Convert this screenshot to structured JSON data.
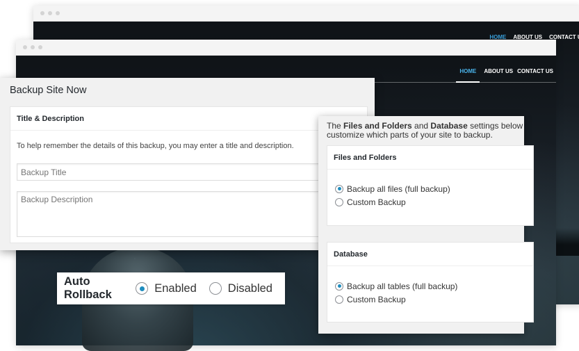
{
  "back_browser": {
    "nav": [
      "HOME",
      "ABOUT US",
      "CONTACT US"
    ]
  },
  "front_browser": {
    "nav": [
      "HOME",
      "ABOUT US",
      "CONTACT US"
    ]
  },
  "backup_panel": {
    "title": "Backup Site Now",
    "section_title": "Title & Description",
    "description": "To help remember the details of this backup, you may enter a title and description.",
    "title_placeholder": "Backup Title",
    "description_placeholder": "Backup Description"
  },
  "settings_panel": {
    "intro_prefix": "The ",
    "intro_files": "Files and Folders",
    "intro_and": " and ",
    "intro_db": "Database",
    "intro_suffix": " settings below customize which parts of your site to backup.",
    "files": {
      "heading": "Files and Folders",
      "options": [
        "Backup all files (full backup)",
        "Custom Backup"
      ],
      "selected": 0
    },
    "database": {
      "heading": "Database",
      "options": [
        "Backup all tables (full backup)",
        "Custom Backup"
      ],
      "selected": 0
    }
  },
  "auto_rollback": {
    "label": "Auto Rollback",
    "options": [
      "Enabled",
      "Disabled"
    ],
    "selected": 0
  },
  "colors": {
    "accent": "#1e8cbe",
    "nav_active": "#3aa1dc"
  }
}
